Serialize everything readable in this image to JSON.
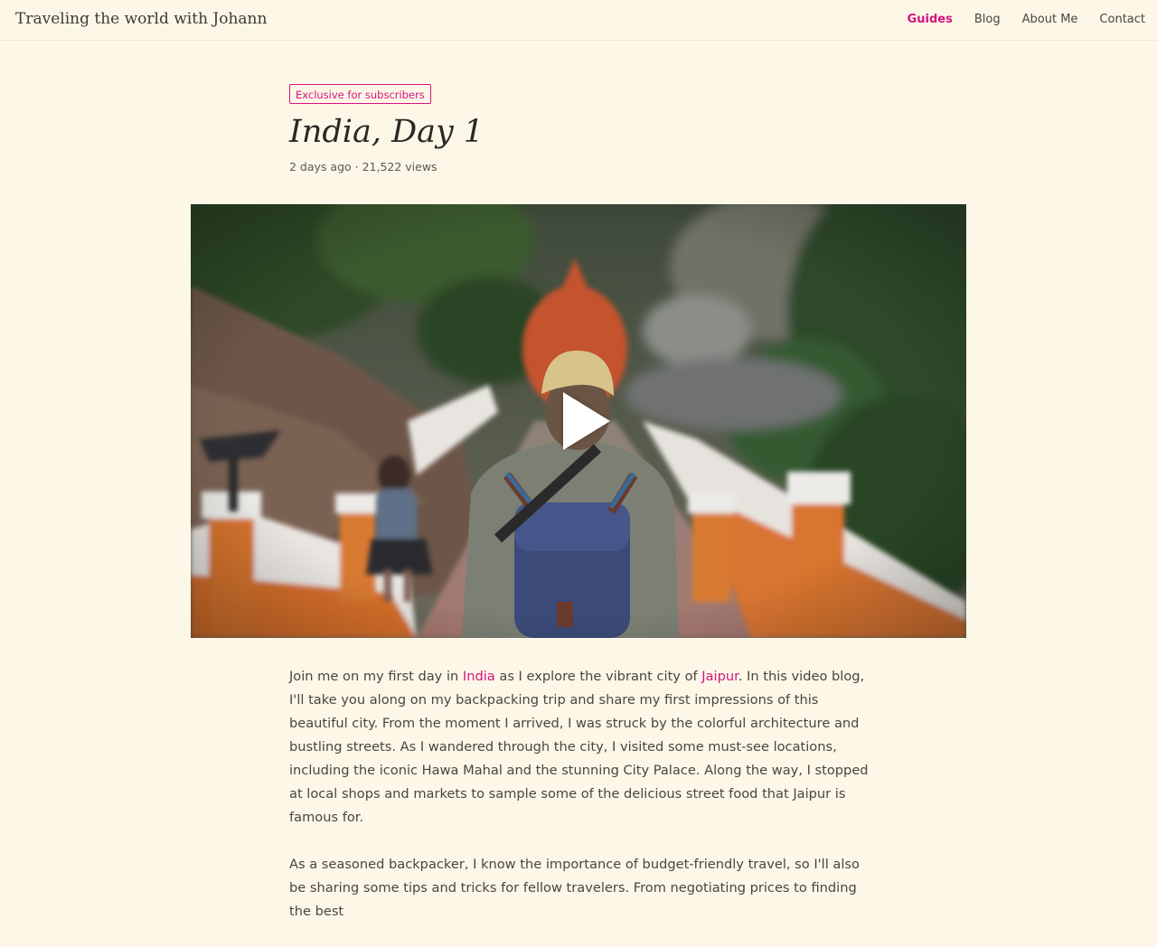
{
  "site": {
    "title": "Traveling the world with Johann"
  },
  "nav": {
    "items": [
      {
        "label": "Guides",
        "active": true
      },
      {
        "label": "Blog",
        "active": false
      },
      {
        "label": "About Me",
        "active": false
      },
      {
        "label": "Contact",
        "active": false
      }
    ]
  },
  "post": {
    "badge": "Exclusive for subscribers",
    "title": "India, Day 1",
    "meta": "2 days ago · 21,522 views",
    "video": {
      "play_icon": "play-icon"
    },
    "paragraphs": [
      {
        "p1_text_a": "Join me on my first day in ",
        "p1_link_india": "India",
        "p1_text_b": " as I explore the vibrant city of ",
        "p1_link_jaipur": "Jaipur",
        "p1_text_c": ". In this video blog, I'll take you along on my backpacking trip and share my first impressions of this beautiful city. From the moment I arrived, I was struck by the colorful architecture and bustling streets. As I wandered through the city, I visited some must-see locations, including the iconic Hawa Mahal and the stunning City Palace. Along the way, I stopped at local shops and markets to sample some of the delicious street food that Jaipur is famous for."
      },
      {
        "text": "As a seasoned backpacker, I know the importance of budget-friendly travel, so I'll also be sharing some tips and tricks for fellow travelers. From negotiating prices to finding the best"
      }
    ]
  },
  "colors": {
    "background": "#fdf7e8",
    "accent": "#d4147e",
    "text": "#4a463d"
  }
}
